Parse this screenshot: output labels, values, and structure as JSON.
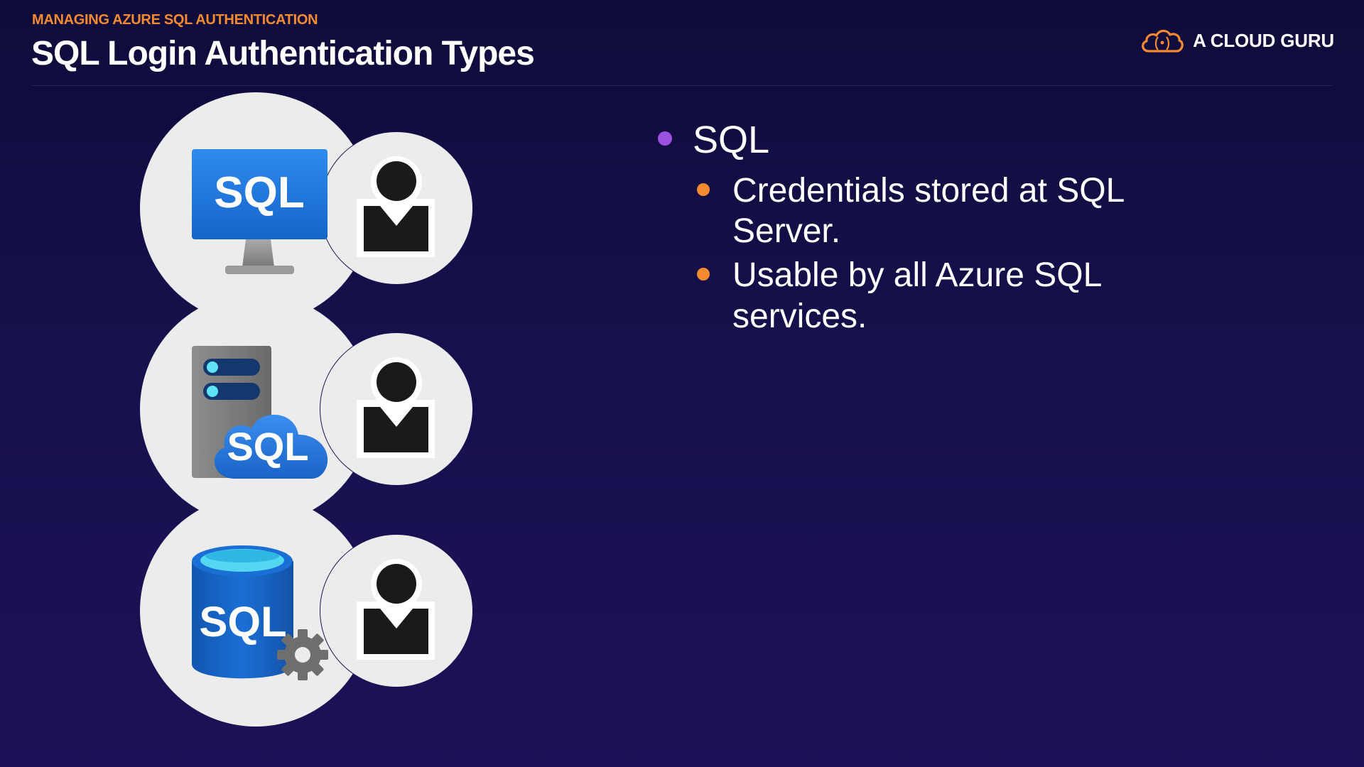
{
  "header": {
    "eyebrow": "MANAGING AZURE SQL AUTHENTICATION",
    "title": "SQL Login Authentication Types",
    "brand": "A CLOUD GURU"
  },
  "icons": [
    {
      "icon": "sql-server-monitor-icon",
      "label": "SQL"
    },
    {
      "icon": "sql-cloud-server-icon",
      "label": "SQL"
    },
    {
      "icon": "sql-database-icon",
      "label": "SQL"
    }
  ],
  "bullets": {
    "main": "SQL",
    "sub": [
      "Credentials stored at SQL Server.",
      "Usable by all Azure SQL services."
    ]
  },
  "colors": {
    "background": "#16104c",
    "accent_orange": "#f48b32",
    "accent_purple": "#9b51e0",
    "sql_blue": "#1c6fd6"
  }
}
